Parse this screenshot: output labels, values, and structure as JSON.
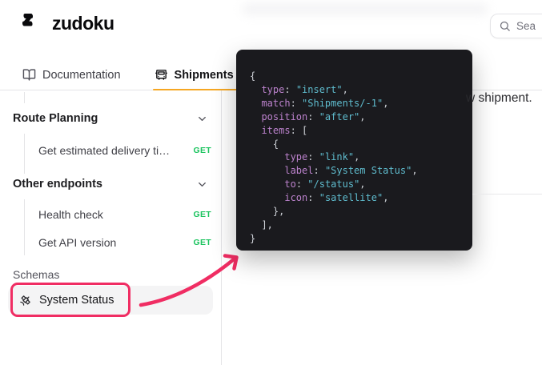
{
  "colors": {
    "pink": "#f02d63",
    "tab_underline": "#f6a723",
    "method_get": "#1cc45f",
    "code_bg": "#1a1a1e",
    "code_key": "#bd83ce",
    "code_value": "#5fbcce"
  },
  "header": {
    "logo_text": "zudoku",
    "search": {
      "icon": "search-icon",
      "visible_text": "Sea"
    }
  },
  "tabs": [
    {
      "label": "Documentation",
      "icon": "book-open-icon",
      "active": false
    },
    {
      "label": "Shipments",
      "icon": "truck-icon",
      "active": true
    }
  ],
  "sidebar": {
    "groups": [
      {
        "label": "Route Planning",
        "icon": "chevron-down-icon",
        "items": [
          {
            "label": "Get estimated delivery ti…",
            "method": "GET"
          }
        ]
      },
      {
        "label": "Other endpoints",
        "icon": "chevron-down-icon",
        "items": [
          {
            "label": "Health check",
            "method": "GET"
          },
          {
            "label": "Get API version",
            "method": "GET"
          }
        ]
      }
    ],
    "schemas_section_label": "Schemas",
    "schema_item": {
      "label": "System Status",
      "icon": "satellite-icon"
    }
  },
  "code_overlay": {
    "lines": [
      [
        {
          "c": "p",
          "t": "{"
        }
      ],
      [
        {
          "c": "p",
          "t": "  "
        },
        {
          "c": "k",
          "t": "type"
        },
        {
          "c": "p",
          "t": ": "
        },
        {
          "c": "v",
          "t": "\"insert\""
        },
        {
          "c": "p",
          "t": ","
        }
      ],
      [
        {
          "c": "p",
          "t": "  "
        },
        {
          "c": "k",
          "t": "match"
        },
        {
          "c": "p",
          "t": ": "
        },
        {
          "c": "v",
          "t": "\"Shipments/-1\""
        },
        {
          "c": "p",
          "t": ","
        }
      ],
      [
        {
          "c": "p",
          "t": "  "
        },
        {
          "c": "k",
          "t": "position"
        },
        {
          "c": "p",
          "t": ": "
        },
        {
          "c": "v",
          "t": "\"after\""
        },
        {
          "c": "p",
          "t": ","
        }
      ],
      [
        {
          "c": "p",
          "t": "  "
        },
        {
          "c": "k",
          "t": "items"
        },
        {
          "c": "p",
          "t": ": ["
        }
      ],
      [
        {
          "c": "p",
          "t": "    {"
        }
      ],
      [
        {
          "c": "p",
          "t": "      "
        },
        {
          "c": "k",
          "t": "type"
        },
        {
          "c": "p",
          "t": ": "
        },
        {
          "c": "v",
          "t": "\"link\""
        },
        {
          "c": "p",
          "t": ","
        }
      ],
      [
        {
          "c": "p",
          "t": "      "
        },
        {
          "c": "k",
          "t": "label"
        },
        {
          "c": "p",
          "t": ": "
        },
        {
          "c": "v",
          "t": "\"System Status\""
        },
        {
          "c": "p",
          "t": ","
        }
      ],
      [
        {
          "c": "p",
          "t": "      "
        },
        {
          "c": "k",
          "t": "to"
        },
        {
          "c": "p",
          "t": ": "
        },
        {
          "c": "v",
          "t": "\"/status\""
        },
        {
          "c": "p",
          "t": ","
        }
      ],
      [
        {
          "c": "p",
          "t": "      "
        },
        {
          "c": "k",
          "t": "icon"
        },
        {
          "c": "p",
          "t": ": "
        },
        {
          "c": "v",
          "t": "\"satellite\""
        },
        {
          "c": "p",
          "t": ","
        }
      ],
      [
        {
          "c": "p",
          "t": "    },"
        }
      ],
      [
        {
          "c": "p",
          "t": "  ],"
        }
      ],
      [
        {
          "c": "p",
          "t": "}"
        }
      ]
    ]
  },
  "content": {
    "partial_text": "w shipment."
  }
}
